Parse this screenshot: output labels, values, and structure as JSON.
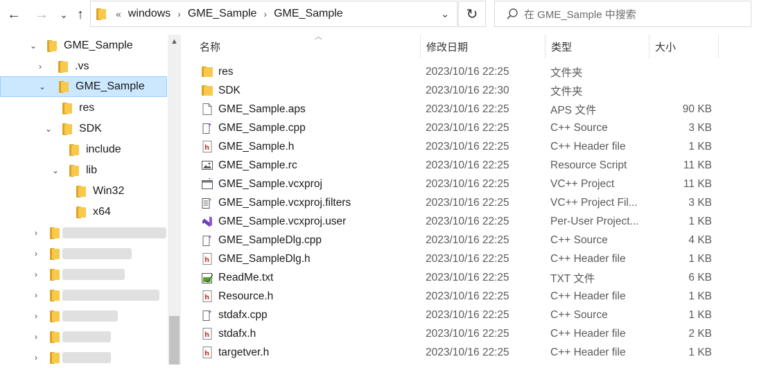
{
  "nav": {
    "back": "←",
    "forward": "→",
    "recent": "⌄",
    "up": "↑"
  },
  "address": {
    "overflow": "«",
    "segments": [
      "windows",
      "GME_Sample",
      "GME_Sample"
    ],
    "separator": "›",
    "dropdown": "⌄",
    "refresh": "↻"
  },
  "search": {
    "placeholder": "在 GME_Sample 中搜索"
  },
  "tree": {
    "items": [
      {
        "label": "GME_Sample",
        "expanded": true
      },
      {
        "label": ".vs",
        "expanded": false
      },
      {
        "label": "GME_Sample",
        "expanded": true,
        "selected": true
      },
      {
        "label": "res"
      },
      {
        "label": "SDK",
        "expanded": true
      },
      {
        "label": "include"
      },
      {
        "label": "lib",
        "expanded": true
      },
      {
        "label": "Win32"
      },
      {
        "label": "x64"
      }
    ]
  },
  "columns": {
    "name": "名称",
    "date": "修改日期",
    "type": "类型",
    "size": "大小"
  },
  "files": [
    {
      "name": "res",
      "date": "2023/10/16 22:25",
      "type": "文件夹",
      "size": "",
      "icon": "folder-icon"
    },
    {
      "name": "SDK",
      "date": "2023/10/16 22:30",
      "type": "文件夹",
      "size": "",
      "icon": "folder-icon"
    },
    {
      "name": "GME_Sample.aps",
      "date": "2023/10/16 22:25",
      "type": "APS 文件",
      "size": "90 KB",
      "icon": "blank-file-icon"
    },
    {
      "name": "GME_Sample.cpp",
      "date": "2023/10/16 22:25",
      "type": "C++ Source",
      "size": "3 KB",
      "icon": "cpp-file-icon"
    },
    {
      "name": "GME_Sample.h",
      "date": "2023/10/16 22:25",
      "type": "C++ Header file",
      "size": "1 KB",
      "icon": "header-file-icon"
    },
    {
      "name": "GME_Sample.rc",
      "date": "2023/10/16 22:25",
      "type": "Resource Script",
      "size": "11 KB",
      "icon": "resource-file-icon"
    },
    {
      "name": "GME_Sample.vcxproj",
      "date": "2023/10/16 22:25",
      "type": "VC++ Project",
      "size": "11 KB",
      "icon": "vcxproj-file-icon"
    },
    {
      "name": "GME_Sample.vcxproj.filters",
      "date": "2023/10/16 22:25",
      "type": "VC++ Project Fil...",
      "size": "3 KB",
      "icon": "filters-file-icon"
    },
    {
      "name": "GME_Sample.vcxproj.user",
      "date": "2023/10/16 22:25",
      "type": "Per-User Project...",
      "size": "1 KB",
      "icon": "visual-studio-icon"
    },
    {
      "name": "GME_SampleDlg.cpp",
      "date": "2023/10/16 22:25",
      "type": "C++ Source",
      "size": "4 KB",
      "icon": "cpp-file-icon"
    },
    {
      "name": "GME_SampleDlg.h",
      "date": "2023/10/16 22:25",
      "type": "C++ Header file",
      "size": "1 KB",
      "icon": "header-file-icon"
    },
    {
      "name": "ReadMe.txt",
      "date": "2023/10/16 22:25",
      "type": "TXT 文件",
      "size": "6 KB",
      "icon": "text-file-icon"
    },
    {
      "name": "Resource.h",
      "date": "2023/10/16 22:25",
      "type": "C++ Header file",
      "size": "1 KB",
      "icon": "header-file-icon"
    },
    {
      "name": "stdafx.cpp",
      "date": "2023/10/16 22:25",
      "type": "C++ Source",
      "size": "1 KB",
      "icon": "cpp-file-icon"
    },
    {
      "name": "stdafx.h",
      "date": "2023/10/16 22:25",
      "type": "C++ Header file",
      "size": "2 KB",
      "icon": "header-file-icon"
    },
    {
      "name": "targetver.h",
      "date": "2023/10/16 22:25",
      "type": "C++ Header file",
      "size": "1 KB",
      "icon": "header-file-icon"
    }
  ]
}
